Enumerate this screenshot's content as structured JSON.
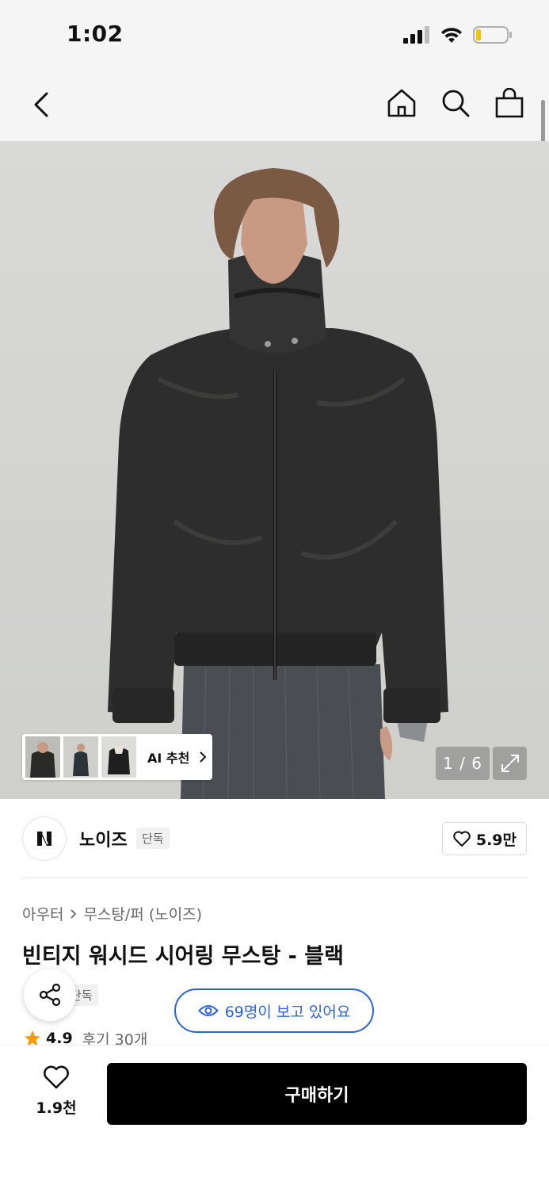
{
  "status_bar": {
    "time": "1:02"
  },
  "nav": {
    "back_icon": "chevron-left-icon",
    "icons": [
      "home-icon",
      "search-icon",
      "shopping-bag-icon"
    ]
  },
  "gallery": {
    "counter": "1 / 6",
    "ai_recommend_label": "AI 추천"
  },
  "brand": {
    "name": "노이즈",
    "badge": "단독",
    "likes": "5.9만"
  },
  "product": {
    "breadcrumb": [
      "아우터",
      "무스탕/퍼 (노이즈)"
    ],
    "title": "빈티지 워시드 시어링 무스탕 - 블랙",
    "badge": "단독",
    "viewers": "69명이 보고 있어요",
    "rating": "4.9",
    "reviews": "후기 30개"
  },
  "bottom": {
    "wish_count": "1.9천",
    "buy_label": "구매하기"
  },
  "colors": {
    "accent_blue": "#2b63d9",
    "star": "#ff9a00",
    "buy_bg": "#000000"
  }
}
